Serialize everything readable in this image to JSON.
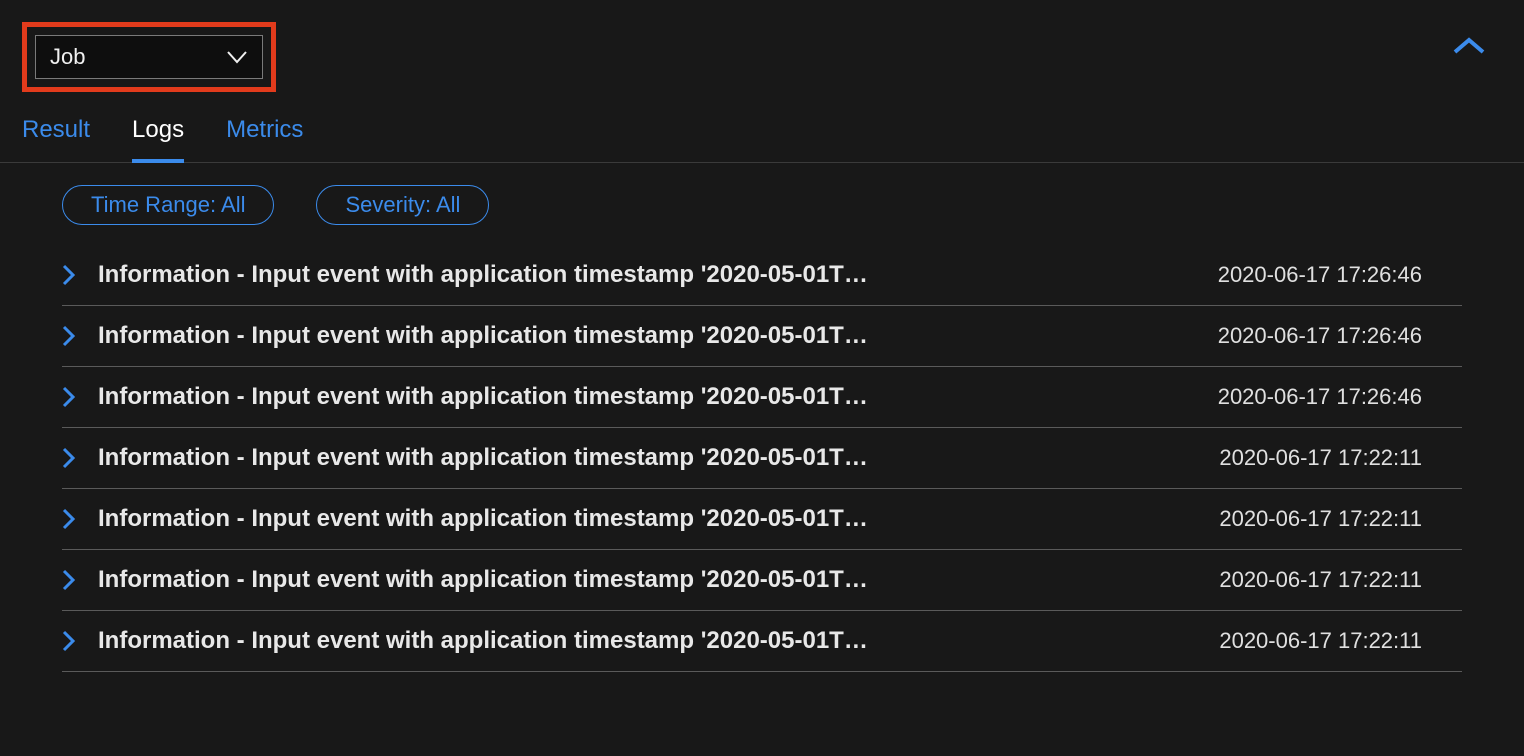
{
  "header": {
    "dropdown_label": "Job"
  },
  "tabs": [
    {
      "label": "Result",
      "active": false
    },
    {
      "label": "Logs",
      "active": true
    },
    {
      "label": "Metrics",
      "active": false
    }
  ],
  "filters": {
    "time_range": "Time Range: All",
    "severity": "Severity: All"
  },
  "logs": [
    {
      "message": "Information - Input event with application timestamp '2020-05-01T…",
      "time": "2020-06-17 17:26:46"
    },
    {
      "message": "Information - Input event with application timestamp '2020-05-01T…",
      "time": "2020-06-17 17:26:46"
    },
    {
      "message": "Information - Input event with application timestamp '2020-05-01T…",
      "time": "2020-06-17 17:26:46"
    },
    {
      "message": "Information - Input event with application timestamp '2020-05-01T…",
      "time": "2020-06-17 17:22:11"
    },
    {
      "message": "Information - Input event with application timestamp '2020-05-01T…",
      "time": "2020-06-17 17:22:11"
    },
    {
      "message": "Information - Input event with application timestamp '2020-05-01T…",
      "time": "2020-06-17 17:22:11"
    },
    {
      "message": "Information - Input event with application timestamp '2020-05-01T…",
      "time": "2020-06-17 17:22:11"
    }
  ]
}
